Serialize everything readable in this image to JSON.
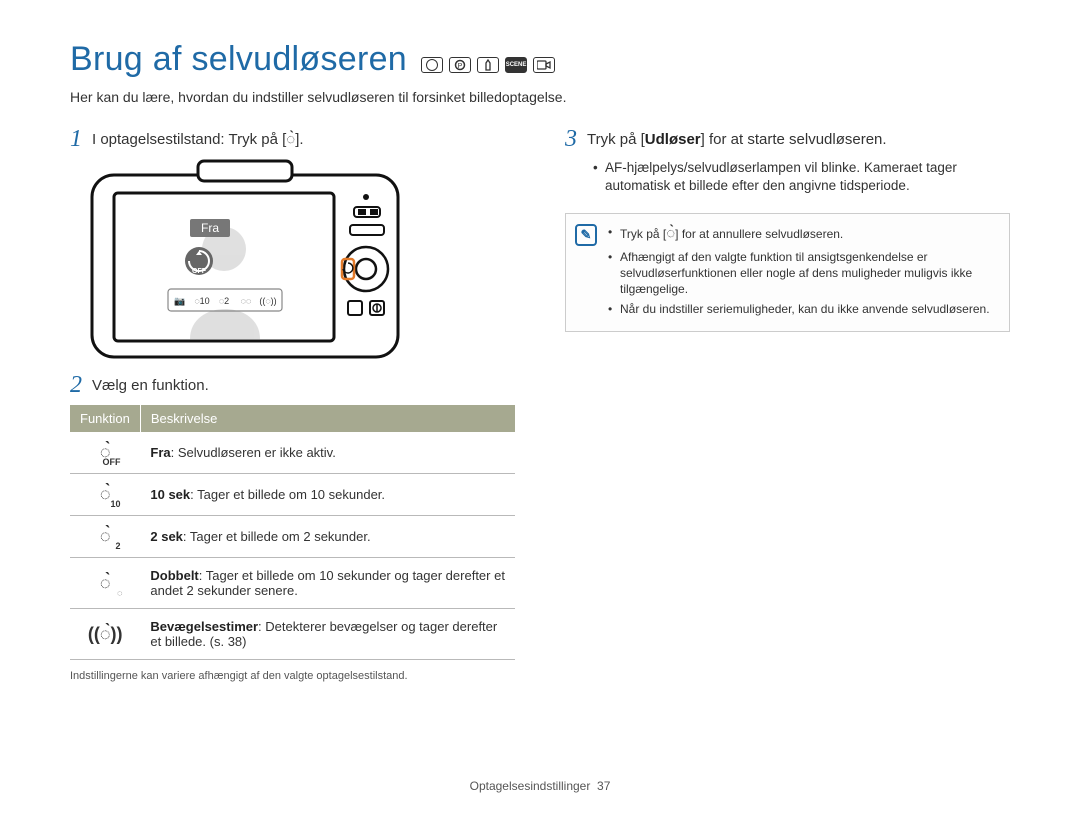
{
  "title": "Brug af selvudløseren",
  "title_modes": [
    "cam",
    "P",
    "hand",
    "SCENE",
    "vid"
  ],
  "intro": "Her kan du lære, hvordan du indstiller selvudløseren til forsinket billedoptagelse.",
  "left": {
    "step1": {
      "num": "1",
      "text_a": "I optagelsestilstand: Tryk på [",
      "text_b": "]."
    },
    "step2": {
      "num": "2",
      "text": "Vælg en funktion."
    },
    "camera_ui": {
      "label": "Fra",
      "off": "OFF"
    },
    "table": {
      "head_funktion": "Funktion",
      "head_beskrivelse": "Beskrivelse",
      "rows": [
        {
          "icon": "OFF",
          "bold": "Fra",
          "rest": ": Selvudløseren er ikke aktiv."
        },
        {
          "icon": "10",
          "bold": "10 sek",
          "rest": ": Tager et billede om 10 sekunder."
        },
        {
          "icon": "2",
          "bold": "2 sek",
          "rest": ": Tager et billede om 2 sekunder."
        },
        {
          "icon": "DBL",
          "bold": "Dobbelt",
          "rest": ": Tager et billede om 10 sekunder og tager derefter et andet 2 sekunder senere."
        },
        {
          "icon": "MOT",
          "bold": "Bevægelsestimer",
          "rest": ": Detekterer bevægelser og tager derefter et billede. (s. 38)"
        }
      ]
    },
    "footnote": "Indstillingerne kan variere afhængigt af den valgte optagelsestilstand."
  },
  "right": {
    "step3": {
      "num": "3",
      "text_a": "Tryk på [",
      "bold": "Udløser",
      "text_b": "] for at starte selvudløseren."
    },
    "bullets": [
      "AF-hjælpelys/selvudløserlampen vil blinke. Kameraet tager automatisk et billede efter den angivne tidsperiode."
    ],
    "note": {
      "items": [
        {
          "pre": "Tryk på [",
          "post": "] for at annullere selvudløseren."
        },
        {
          "text": "Afhængigt af den valgte funktion til ansigtsgenkendelse er selvudløserfunktionen eller nogle af dens muligheder muligvis ikke tilgængelige."
        },
        {
          "text": "Når du indstiller seriemuligheder, kan du ikke anvende selvudløseren."
        }
      ]
    }
  },
  "footer": {
    "section": "Optagelsesindstillinger",
    "page": "37"
  }
}
